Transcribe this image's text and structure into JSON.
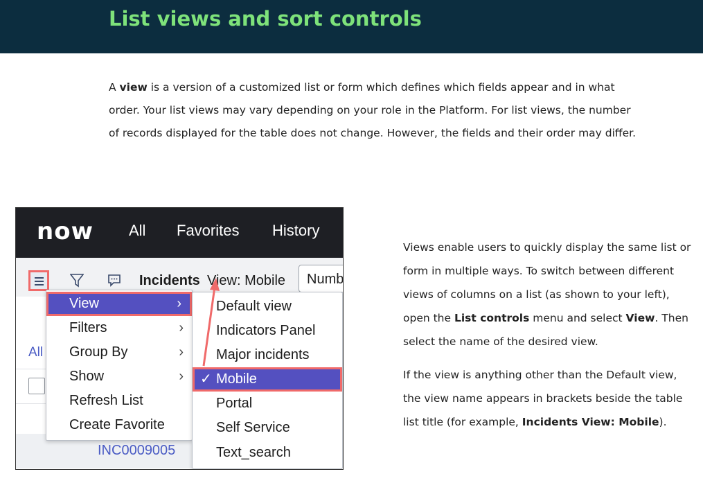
{
  "header": {
    "title": "List views and sort controls"
  },
  "intro": {
    "text": "A view is a version of a customized list or form which defines which fields appear and in what order. Your list views may vary depending on your role in the Platform. For list views, the number of records displayed for the table does not change. However, the fields and their order may differ.",
    "pre": "A ",
    "bold": "view",
    "post": " is a version of a customized list or form which defines which fields appear and in what order. Your list views may vary depending on your role in the Platform. For list views, the number of records displayed for the table does not change. However, the fields and their order may differ."
  },
  "side": {
    "p1_a": "Views enable users to quickly display the same list or form in multiple ways. To switch between different views of columns on a list (as shown to your left), open the ",
    "p1_b": "List controls",
    "p1_c": " menu and select ",
    "p1_d": "View",
    "p1_e": ". Then select the name of the desired view.",
    "p2_a": "If the view is anything other than the Default view, the view name appears in brackets beside the table list title (for example, ",
    "p2_b": "Incidents View: Mobile",
    "p2_c": ")."
  },
  "screenshot": {
    "logo": "now",
    "nav": [
      "All",
      "Favorites",
      "History"
    ],
    "toolbar": {
      "title": "Incidents",
      "view_label": "View: Mobile",
      "search_field": "Numb"
    },
    "background": {
      "all_link": "All",
      "record": "INC0009005"
    },
    "context_menu": [
      "View",
      "Filters",
      "Group By",
      "Show",
      "Refresh List",
      "Create Favorite"
    ],
    "submenu": [
      "Default view",
      "Indicators Panel",
      "Major incidents",
      "Mobile",
      "Portal",
      "Self Service",
      "Text_search"
    ],
    "selected_view": "Mobile"
  },
  "colors": {
    "banner": "#0c2d3f",
    "title": "#7ee27a",
    "highlight": "#5450c0",
    "callout": "#f06a6a"
  }
}
